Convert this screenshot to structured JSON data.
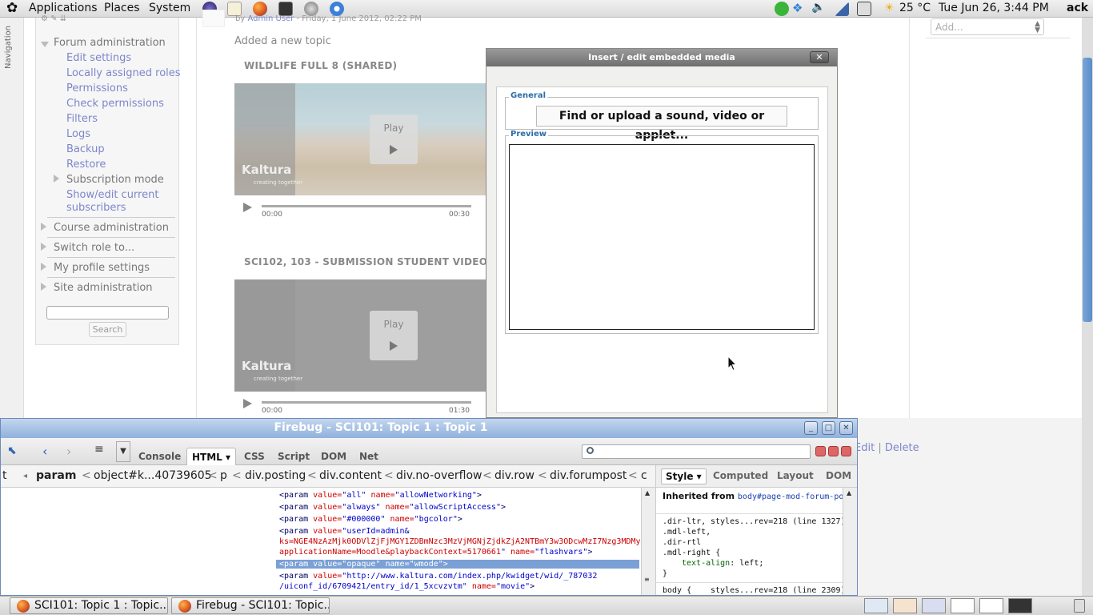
{
  "top_panel": {
    "menus": [
      "Applications",
      "Places",
      "System"
    ],
    "weather": "25 °C",
    "clock": "Tue Jun 26,  3:44 PM",
    "user": "ack"
  },
  "sidebar": {
    "navigation_label": "Navigation",
    "forum_admin": "Forum administration",
    "forum_items": [
      "Edit settings",
      "Locally assigned roles",
      "Permissions",
      "Check permissions",
      "Filters",
      "Logs",
      "Backup",
      "Restore"
    ],
    "subscription_mode": "Subscription mode",
    "show_edit_line1": "Show/edit current",
    "show_edit_line2": "subscribers",
    "sections": [
      "Course administration",
      "Switch role to...",
      "My profile settings",
      "Site administration"
    ],
    "search_button": "Search"
  },
  "main": {
    "post_meta_prefix": "by ",
    "post_author": "Admin User",
    "post_date": " - Friday, 1 June 2012, 02:22 PM",
    "added_topic": "Added a new topic",
    "media": [
      {
        "title": "WILDLIFE FULL 8 (SHARED)",
        "play": "Play",
        "time_start": "00:00",
        "time_end": "00:30",
        "logo": "Kaltura",
        "logo_sub": "creating together"
      },
      {
        "title": "SCI102, 103 - SUBMISSION STUDENT VIDEO 2",
        "play": "Play",
        "time_start": "00:00",
        "time_end": "01:30",
        "logo": "Kaltura",
        "logo_sub": "creating together"
      }
    ],
    "edit_link": "Edit",
    "delete_link": "Delete",
    "link_separator": "|"
  },
  "right_block": {
    "add_placeholder": "Add..."
  },
  "media_dialog": {
    "title": "Insert / edit embedded media",
    "close": "✕",
    "general_legend": "General",
    "find_button": "Find or upload a sound, video or applet...",
    "preview_legend": "Preview"
  },
  "firebug": {
    "title": "Firebug - SCI101: Topic 1 : Topic 1",
    "tabs": [
      "Console",
      "HTML ▾",
      "CSS",
      "Script",
      "DOM",
      "Net"
    ],
    "breadcrumbs": [
      "t",
      "param",
      "object#k...40739605",
      "p",
      "div.posting",
      "div.content",
      "div.no-overflow",
      "div.row",
      "div.forumpost",
      "c"
    ],
    "side_tabs": [
      "Style ▾",
      "Computed",
      "Layout",
      "DOM"
    ],
    "html_lines": [
      {
        "value": "all",
        "name": "allowNetworking"
      },
      {
        "value": "always",
        "name": "allowScriptAccess"
      },
      {
        "value": "#000000",
        "name": "bgcolor"
      }
    ],
    "flashvars_line1": "userId=admin&",
    "flashvars_line2": "ks=NGE4NzAzMjk0ODVlZjFjMGY1ZDBmNzc3MzVjMGNjZjdkZjA2NTBmY3w3ODcwMzI7Nzg3MDMy",
    "flashvars_line3": "applicationName=Moodle&playbackContext=5170661",
    "flashvars_name": "flashvars",
    "wmode_value": "opaque",
    "wmode_name": "wmode",
    "movie_line1": "http://www.kaltura.com/index.php/kwidget/wid/_787032",
    "movie_line2": "/uiconf_id/6709421/entry_id/1_5xcvzvtm",
    "movie_name": "movie",
    "param_tag": "<param",
    "value_attr": "value=",
    "name_attr": "name=",
    "tag_close": ">",
    "style": {
      "inherited_label": "Inherited from ",
      "inherited_sel": "body#page-mod-forum-post.path-mod",
      "rule1_selectors": [
        ".dir-ltr,",
        ".mdl-left,",
        ".dir-rtl",
        ".mdl-right {"
      ],
      "rule1_source": "styles...rev=218 (line 1327)",
      "rule1_prop": "text-align",
      "rule1_val": "left;",
      "rule1_close": "}",
      "rule2_selector": "body {",
      "rule2_source": "styles...rev=218 (line 2309)"
    }
  },
  "taskbar": {
    "tasks": [
      "SCI101: Topic 1 : Topic...",
      "Firebug - SCI101: Topic..."
    ]
  }
}
